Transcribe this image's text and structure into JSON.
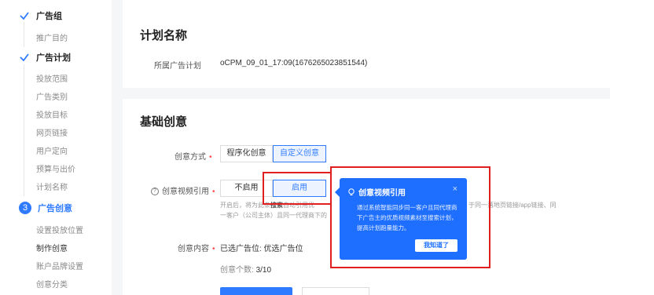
{
  "sidebar": {
    "steps": [
      {
        "label": "广告组",
        "subs": [
          "推广目的"
        ]
      },
      {
        "label": "广告计划",
        "subs": [
          "投放范围",
          "广告类别",
          "投放目标",
          "网页链接",
          "用户定向",
          "预算与出价",
          "计划名称"
        ]
      },
      {
        "number": "3",
        "label": "广告创意",
        "subs": [
          "设置投放位置",
          "制作创意",
          "账户品牌设置",
          "创意分类"
        ]
      }
    ]
  },
  "plan_section": {
    "title": "计划名称",
    "label": "所属广告计划",
    "value": "oCPM_09_01_17:09(1676265023851544)"
  },
  "creative_section": {
    "title": "基础创意",
    "mode_label": "创意方式",
    "mode_options": [
      "程序化创意",
      "自定义创意"
    ],
    "video_ref_label": "创意视频引用",
    "video_ref_options": [
      "不启用",
      "启用"
    ],
    "hint_line1_pre": "开启后，将为此条",
    "hint_line1_bold": "搜索计划",
    "hint_line1_post": "自动引用优",
    "hint_line1_tail": "于同一落地页链接/app链接、同",
    "hint_line2": "一客户（公司主体）且同一代理商下的",
    "content_label": "创意内容",
    "content_value": "已选广告位:  优选广告位",
    "count_label": "创意个数: ",
    "count_value": "3/10"
  },
  "popover": {
    "title": "创意视频引用",
    "close": "×",
    "body": "通过系统智能同步同一客户且同代理商下广告主的优质视频素材至搜索计划，提高计划跑量能力。",
    "button": "我知道了"
  },
  "colors": {
    "accent": "#2f7bff",
    "required": "#ff4d4f",
    "highlight": "#e02020",
    "popover": "#1e6fff"
  }
}
